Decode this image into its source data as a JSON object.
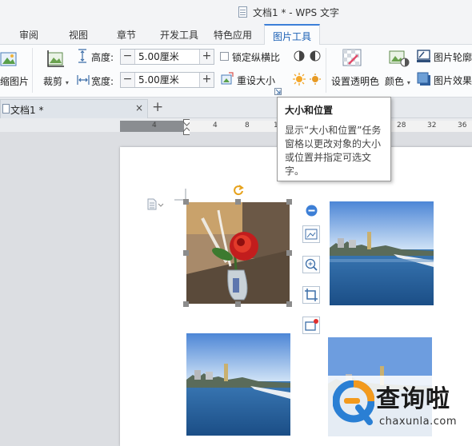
{
  "title_bar": {
    "title": "文档1 * - WPS 文字"
  },
  "menu": {
    "tabs": [
      {
        "label": "审阅"
      },
      {
        "label": "视图"
      },
      {
        "label": "章节"
      },
      {
        "label": "开发工具"
      },
      {
        "label": "特色应用"
      },
      {
        "label": "图片工具",
        "active": true
      }
    ]
  },
  "ribbon": {
    "compress_label": "缩图片",
    "crop_label": "裁剪",
    "height_label": "高度:",
    "height_value": "5.00厘米",
    "width_label": "宽度:",
    "width_value": "5.00厘米",
    "lock_ratio_label": "锁定纵横比",
    "lock_ratio_checked": false,
    "reset_size_label": "重设大小",
    "transparent_label": "设置透明色",
    "color_label": "颜色",
    "outline_label": "图片轮廓",
    "effects_label": "图片效果",
    "minus": "−",
    "plus": "+"
  },
  "document_tabs": {
    "tabs": [
      {
        "name": "文档1 *"
      }
    ],
    "close_symbol": "×",
    "add_symbol": "+"
  },
  "ruler": {
    "ticks": [
      "4",
      "4",
      "8",
      "10",
      "28",
      "32",
      "36"
    ]
  },
  "tooltip": {
    "title": "大小和位置",
    "body": "显示“大小和位置”任务窗格以更改对象的大小或位置并指定可选文字。"
  },
  "watermark": {
    "chinese": "查询啦",
    "url": "chaxunla.com"
  },
  "colors": {
    "accent": "#3c7fd8",
    "ribbon_bg": "#fbfcfd",
    "ruler_dark": "#8a8d91",
    "watermark_blue": "#2a7fd4",
    "watermark_orange": "#f39a1e"
  }
}
